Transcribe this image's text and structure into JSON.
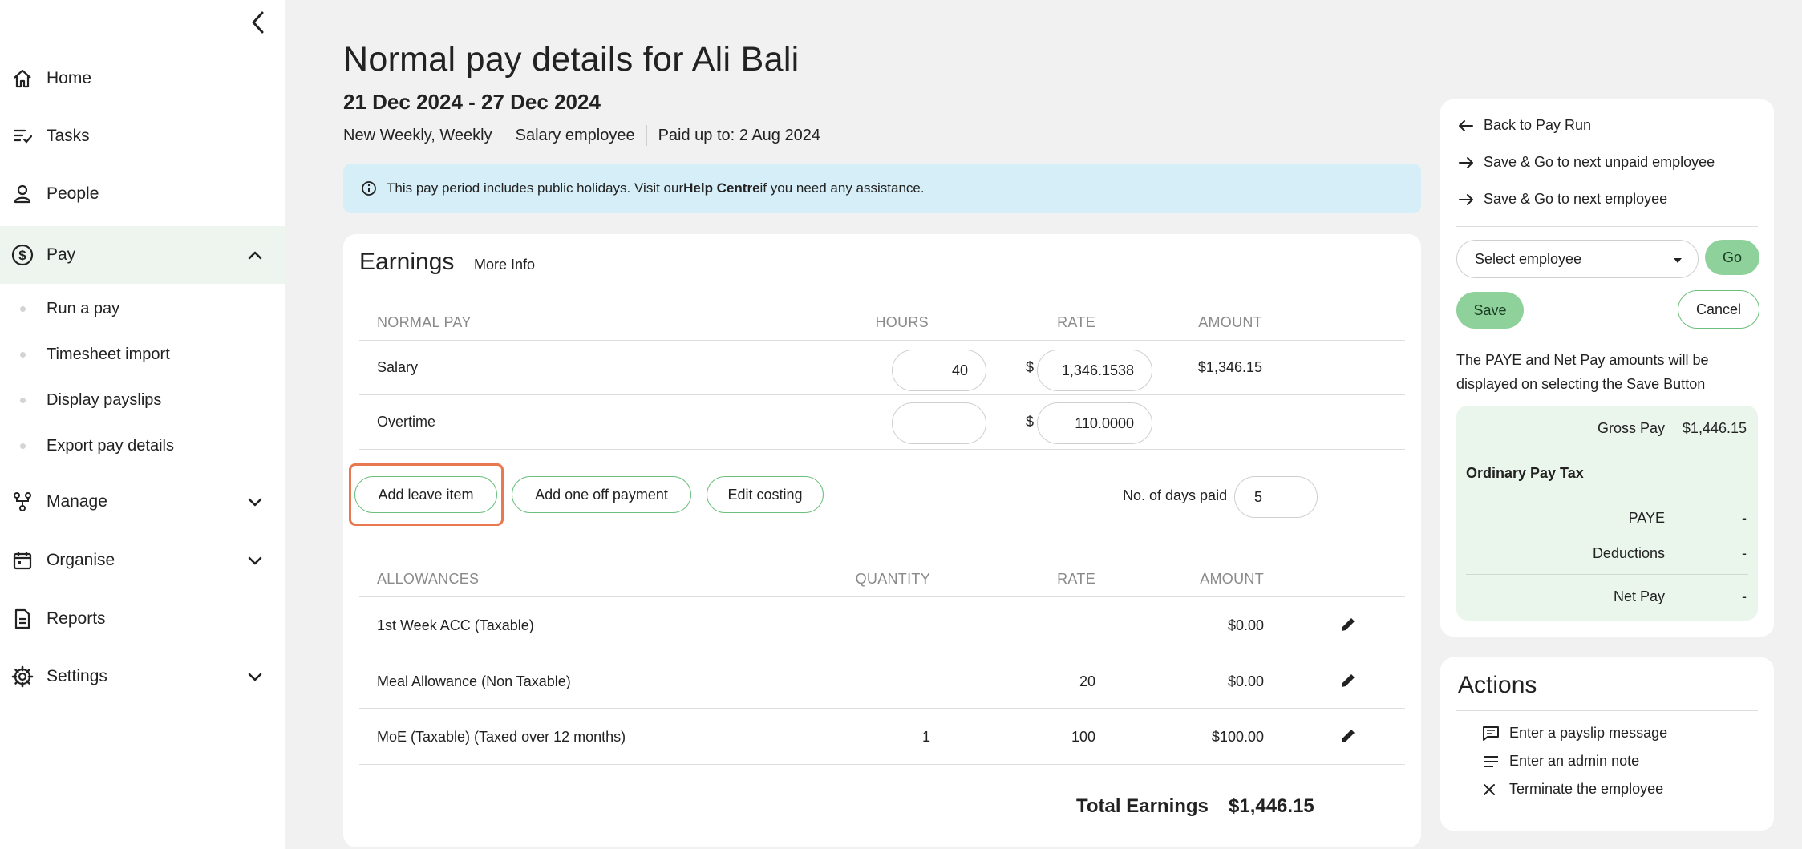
{
  "sidebar": {
    "items": [
      {
        "label": "Home",
        "icon": "home-icon"
      },
      {
        "label": "Tasks",
        "icon": "tasks-icon"
      },
      {
        "label": "People",
        "icon": "person-icon"
      },
      {
        "label": "Pay",
        "icon": "dollar-circle-icon"
      },
      {
        "label": "Manage",
        "icon": "org-chart-icon"
      },
      {
        "label": "Organise",
        "icon": "calendar-icon"
      },
      {
        "label": "Reports",
        "icon": "document-icon"
      },
      {
        "label": "Settings",
        "icon": "gear-icon"
      }
    ],
    "pay_subitems": [
      "Run a pay",
      "Timesheet import",
      "Display payslips",
      "Export pay details"
    ]
  },
  "header": {
    "title": "Normal pay details for Ali Bali",
    "period": "21 Dec 2024 - 27 Dec 2024",
    "meta": [
      "New Weekly, Weekly",
      "Salary employee",
      "Paid up to: 2 Aug 2024"
    ]
  },
  "banner": {
    "before": "This pay period includes public holidays. Visit our ",
    "link": "Help Centre",
    "after": " if you need any assistance."
  },
  "earnings": {
    "title": "Earnings",
    "more_info": "More Info",
    "normal_headers": {
      "name": "NORMAL PAY",
      "hours": "HOURS",
      "rate": "RATE",
      "amount": "AMOUNT"
    },
    "normal_rows": [
      {
        "name": "Salary",
        "hours": "40",
        "rate": "1,346.1538",
        "amount": "$1,346.15"
      },
      {
        "name": "Overtime",
        "hours": "",
        "rate": "110.0000",
        "amount": ""
      }
    ],
    "currency": "$",
    "buttons": {
      "add_leave": "Add leave item",
      "add_one_off": "Add one off payment",
      "edit_costing": "Edit costing"
    },
    "days_paid_label": "No. of days paid",
    "days_paid_value": "5",
    "allowance_headers": {
      "name": "ALLOWANCES",
      "quantity": "QUANTITY",
      "rate": "RATE",
      "amount": "AMOUNT"
    },
    "allowance_rows": [
      {
        "name": "1st Week ACC (Taxable)",
        "quantity": "",
        "rate": "",
        "amount": "$0.00"
      },
      {
        "name": "Meal Allowance (Non Taxable)",
        "quantity": "",
        "rate": "20",
        "amount": "$0.00"
      },
      {
        "name": "MoE (Taxable) (Taxed over 12 months)",
        "quantity": "1",
        "rate": "100",
        "amount": "$100.00"
      }
    ],
    "total_label": "Total Earnings",
    "total_value": "$1,446.15"
  },
  "side": {
    "links": [
      "Back to Pay Run",
      "Save & Go to next unpaid employee",
      "Save & Go to next employee"
    ],
    "select_placeholder": "Select employee",
    "go": "Go",
    "save": "Save",
    "cancel": "Cancel",
    "note": "The PAYE and Net Pay amounts will be displayed on selecting the Save Button",
    "summary": {
      "gross_label": "Gross Pay",
      "gross_value": "$1,446.15",
      "section": "Ordinary Pay Tax",
      "paye_label": "PAYE",
      "paye_value": "-",
      "deductions_label": "Deductions",
      "deductions_value": "-",
      "net_label": "Net Pay",
      "net_value": "-"
    }
  },
  "actions": {
    "title": "Actions",
    "items": [
      "Enter a payslip message",
      "Enter an admin note",
      "Terminate the employee"
    ]
  },
  "colors": {
    "accent_green": "#8fd19b",
    "banner_blue": "#d5eef7",
    "highlight_orange": "#e8784f"
  }
}
